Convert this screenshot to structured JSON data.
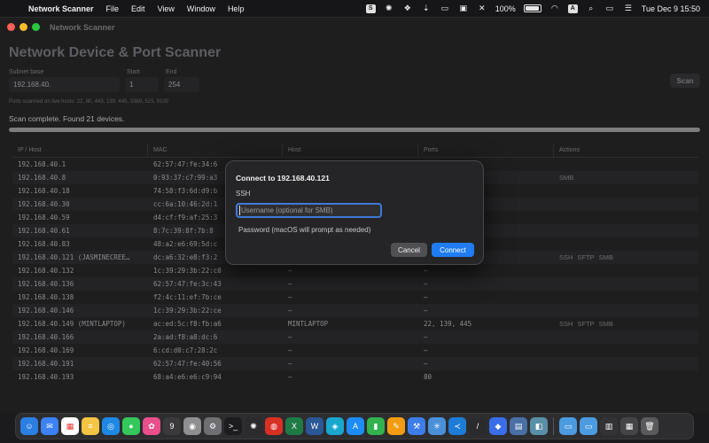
{
  "menubar": {
    "app_name": "Network Scanner",
    "menus": [
      "File",
      "Edit",
      "View",
      "Window",
      "Help"
    ],
    "battery": "100%",
    "input_source": "A",
    "datetime": "Tue Dec 9  15:50"
  },
  "window": {
    "title": "Network Scanner",
    "heading": "Network Device & Port Scanner",
    "subnet": {
      "label": "Subnet base",
      "value": "192.168.40."
    },
    "start": {
      "label": "Start",
      "value": "1"
    },
    "end": {
      "label": "End",
      "value": "254"
    },
    "ports_note": "Ports scanned on live hosts: 22, 80, 443, 139, 445, 3389, 515, 9100",
    "scan_button": "Scan",
    "status": "Scan complete. Found 21 devices.",
    "progress": 1.0
  },
  "table": {
    "columns": [
      "IP / Host",
      "MAC",
      "Host",
      "Ports",
      "Actions"
    ],
    "rows": [
      {
        "ip": "192.168.40.1",
        "mac": "62:57:47:fe:34:6",
        "host": "",
        "ports": "",
        "actions": ""
      },
      {
        "ip": "192.168.40.8",
        "mac": "0:93:37:c7:99:a3",
        "host": "",
        "ports": "",
        "actions": "SMB"
      },
      {
        "ip": "192.168.40.18",
        "mac": "74:58:f3:6d:d9:b",
        "host": "",
        "ports": "",
        "actions": ""
      },
      {
        "ip": "192.168.40.30",
        "mac": "cc:6a:10:46:2d:1",
        "host": "",
        "ports": "",
        "actions": ""
      },
      {
        "ip": "192.168.40.59",
        "mac": "d4:cf:f9:af:25:3",
        "host": "",
        "ports": "",
        "actions": ""
      },
      {
        "ip": "192.168.40.61",
        "mac": "8:7c:39:8f:7b:8",
        "host": "",
        "ports": "",
        "actions": ""
      },
      {
        "ip": "192.168.40.83",
        "mac": "48:a2:e6:69:5d:c",
        "host": "",
        "ports": "",
        "actions": ""
      },
      {
        "ip": "192.168.40.121 (JASMINECREE…",
        "mac": "dc:a6:32:e8:f3:2",
        "host": "",
        "ports": "",
        "actions": "SSH SFTP SMB"
      },
      {
        "ip": "192.168.40.132",
        "mac": "1c:39:29:3b:22:c0",
        "host": "—",
        "ports": "—",
        "actions": ""
      },
      {
        "ip": "192.168.40.136",
        "mac": "62:57:47:fe:3c:43",
        "host": "—",
        "ports": "—",
        "actions": ""
      },
      {
        "ip": "192.168.40.138",
        "mac": "f2:4c:11:ef:7b:ce",
        "host": "—",
        "ports": "—",
        "actions": ""
      },
      {
        "ip": "192.168.40.146",
        "mac": "1c:39:29:3b:22:ce",
        "host": "—",
        "ports": "—",
        "actions": ""
      },
      {
        "ip": "192.168.40.149 (MINTLAPTOP)",
        "mac": "ac:ed:5c:f8:fb:a6",
        "host": "MINTLAPTOP",
        "ports": "22, 139, 445",
        "actions": "SSH SFTP SMB"
      },
      {
        "ip": "192.168.40.166",
        "mac": "2a:ad:f8:a8:dc:6",
        "host": "—",
        "ports": "—",
        "actions": ""
      },
      {
        "ip": "192.168.40.169",
        "mac": "6:cd:d0:c7:28:2c",
        "host": "—",
        "ports": "—",
        "actions": ""
      },
      {
        "ip": "192.168.40.191",
        "mac": "62:57:47:fe:40:56",
        "host": "—",
        "ports": "—",
        "actions": ""
      },
      {
        "ip": "192.168.40.193",
        "mac": "68:a4:e6:e6:c9:94",
        "host": "—",
        "ports": "80",
        "actions": ""
      }
    ]
  },
  "dialog": {
    "title": "Connect to 192.168.40.121",
    "protocol": "SSH",
    "username_placeholder": "Username (optional for SMB)",
    "password_note": "Password (macOS will prompt as needed)",
    "cancel": "Cancel",
    "connect": "Connect"
  },
  "dock": {
    "icons": [
      {
        "name": "finder-icon",
        "color": "#2a7fe0",
        "glyph": "☺"
      },
      {
        "name": "mail-icon",
        "color": "#3b82f6",
        "glyph": "✉"
      },
      {
        "name": "calendar-icon",
        "color": "#ffffff",
        "glyph": "▦"
      },
      {
        "name": "notes-icon",
        "color": "#f4c542",
        "glyph": "≡"
      },
      {
        "name": "safari-icon",
        "color": "#1e88e5",
        "glyph": "◎"
      },
      {
        "name": "messages-icon",
        "color": "#34c759",
        "glyph": "●"
      },
      {
        "name": "photos-icon",
        "color": "#e94f8a",
        "glyph": "✿"
      },
      {
        "name": "calendar-day-icon",
        "color": "#3a3a3c",
        "glyph": "9"
      },
      {
        "name": "contacts-icon",
        "color": "#8e8e93",
        "glyph": "◉"
      },
      {
        "name": "settings-icon",
        "color": "#6e6e73",
        "glyph": "⚙"
      },
      {
        "name": "terminal-icon",
        "color": "#1c1c1e",
        "glyph": ">_"
      },
      {
        "name": "chatgpt-icon",
        "color": "#2b2b2d",
        "glyph": "✺"
      },
      {
        "name": "chrome-icon",
        "color": "#d93025",
        "glyph": "◍"
      },
      {
        "name": "excel-icon",
        "color": "#1f7a44",
        "glyph": "X"
      },
      {
        "name": "word-icon",
        "color": "#2b5797",
        "glyph": "W"
      },
      {
        "name": "network-icon",
        "color": "#19a7ce",
        "glyph": "◈"
      },
      {
        "name": "appstore-icon",
        "color": "#1d8cf8",
        "glyph": "A"
      },
      {
        "name": "numbers-icon",
        "color": "#32b34d",
        "glyph": "▮"
      },
      {
        "name": "pages-icon",
        "color": "#f39c12",
        "glyph": "✎"
      },
      {
        "name": "xcode-icon",
        "color": "#3d7de8",
        "glyph": "⚒"
      },
      {
        "name": "instruments-icon",
        "color": "#4a90d9",
        "glyph": "✳"
      },
      {
        "name": "vscode-icon",
        "color": "#1e7cd6",
        "glyph": "≺"
      },
      {
        "name": "pencil-icon",
        "color": "#2b2b2d",
        "glyph": "/"
      },
      {
        "name": "books-icon",
        "color": "#3a6ee8",
        "glyph": "◆"
      },
      {
        "name": "preview-icon",
        "color": "#4a6fa5",
        "glyph": "▤"
      },
      {
        "name": "automator-icon",
        "color": "#5a8fa8",
        "glyph": "◧"
      },
      {
        "name": "folder-icon",
        "color": "#4b9be0",
        "glyph": "▭"
      },
      {
        "name": "downloads-folder-icon",
        "color": "#4b9be0",
        "glyph": "▭"
      },
      {
        "name": "screenshot-stack-icon",
        "color": "#333336",
        "glyph": "▥"
      },
      {
        "name": "grid-stack-icon",
        "color": "#444447",
        "glyph": "▦"
      },
      {
        "name": "trash-icon",
        "color": "#5a5a5e",
        "glyph": "🗑"
      }
    ]
  }
}
